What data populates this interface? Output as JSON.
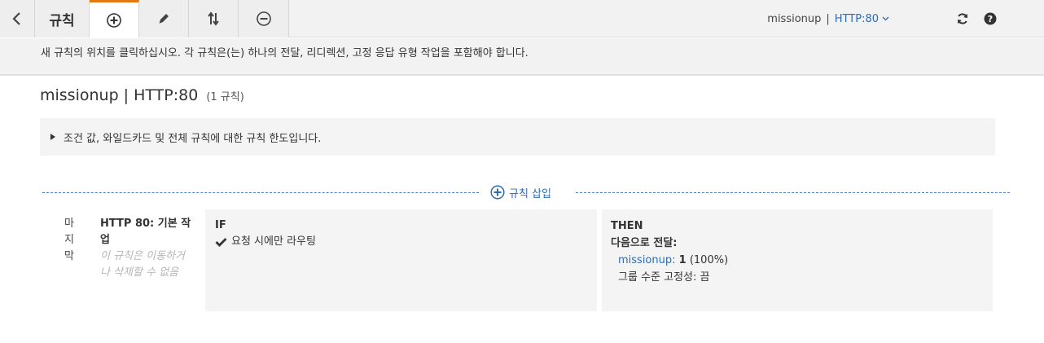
{
  "toolbar": {
    "title": "규칙",
    "load_balancer": "missionup",
    "separator": "|",
    "protocol": "HTTP:80",
    "icons": [
      "back-chevron-icon",
      "add-circle-icon",
      "pencil-icon",
      "sort-arrows-icon",
      "remove-circle-icon",
      "refresh-icon",
      "help-icon"
    ],
    "accent_color": "#e47911"
  },
  "info_message": "새 규칙의 위치를 클릭하십시오. 각 규칙은(는) 하나의 전달, 리디렉션, 고정 응답 유형 작업을 포함해야 합니다.",
  "listener": {
    "title": "missionup | HTTP:80",
    "rule_count": "(1 규칙)"
  },
  "limits_toggle": "조건 값, 와일드카드 및 전체 규칙에 대한 규칙 한도입니다.",
  "insert_rule_label": "규칙 삽입",
  "rule": {
    "order": [
      "마",
      "지",
      "막"
    ],
    "name": "HTTP 80: 기본 작업",
    "note": "이 규칙은 이동하거나 삭제할 수 없음",
    "if": {
      "label": "IF",
      "condition": "요청 시에만 라우팅"
    },
    "then": {
      "label": "THEN",
      "action": "다음으로 전달:",
      "target_group": "missionup:",
      "weight": "1",
      "percent": "(100%)",
      "stickiness": "그룹 수준 고정성: 끔"
    }
  }
}
